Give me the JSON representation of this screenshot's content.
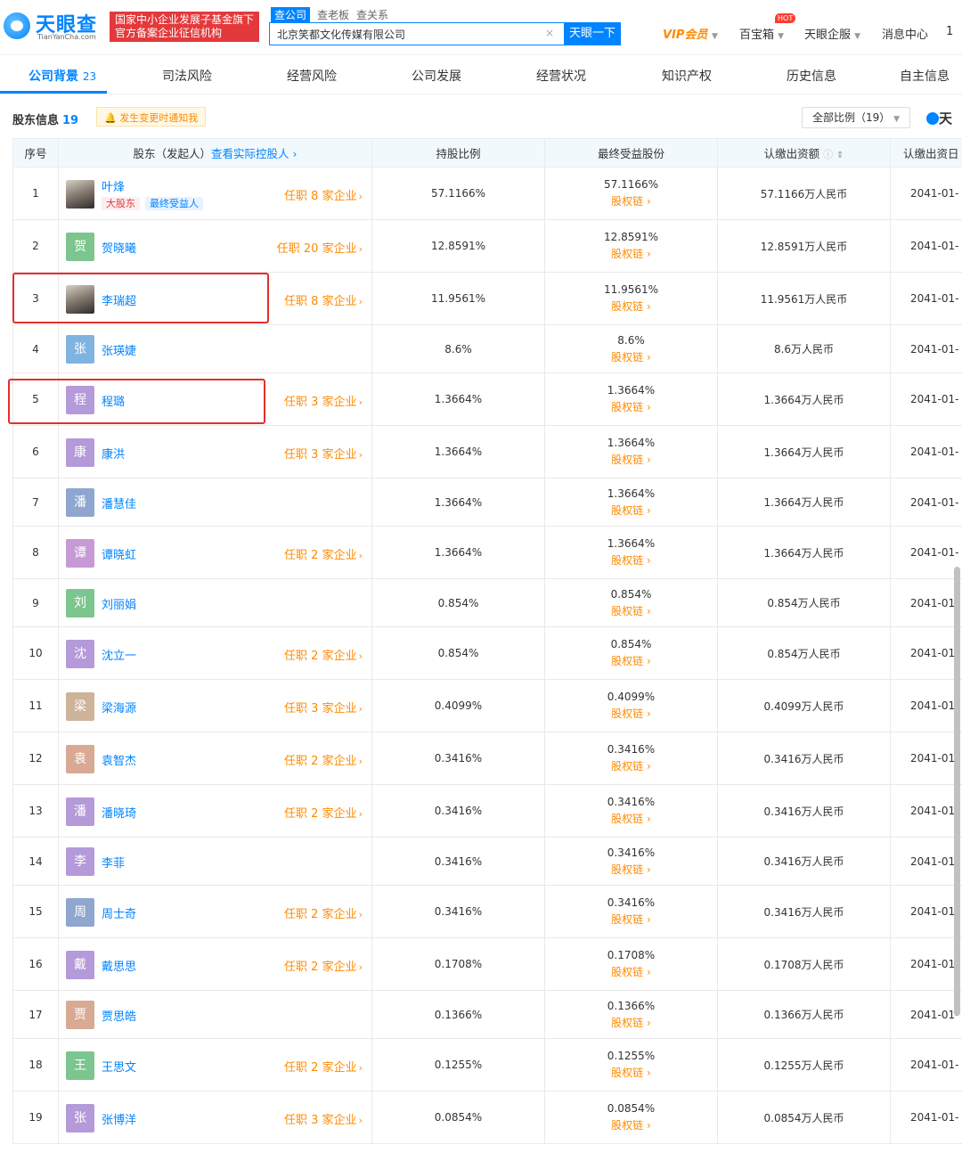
{
  "brand": {
    "name": "天眼查",
    "domain": "TianYanCha.com",
    "banner_line1": "国家中小企业发展子基金旗下",
    "banner_line2": "官方备案企业征信机构"
  },
  "search": {
    "tabs": [
      "查公司",
      "查老板",
      "查关系"
    ],
    "value": "北京笑都文化传媒有限公司",
    "clear": "×",
    "button": "天眼一下"
  },
  "nav": {
    "vip": "VIP会员",
    "baobox": "百宝箱",
    "hot": "HOT",
    "enterprise": "天眼企服",
    "messages": "消息中心",
    "extra": "1"
  },
  "tabs": [
    {
      "label": "公司背景",
      "count": "23"
    },
    {
      "label": "司法风险"
    },
    {
      "label": "经营风险"
    },
    {
      "label": "公司发展"
    },
    {
      "label": "经营状况"
    },
    {
      "label": "知识产权"
    },
    {
      "label": "历史信息"
    },
    {
      "label": "自主信息"
    }
  ],
  "section": {
    "title": "股东信息",
    "count": "19",
    "notify": "发生变更时通知我",
    "filter": "全部比例（19）",
    "brand_short": "天"
  },
  "table": {
    "headers": {
      "seq": "序号",
      "holder": "股东（发起人）",
      "holder_link": "查看实际控股人",
      "ratio": "持股比例",
      "benefit": "最终受益股份",
      "capital": "认缴出资额",
      "date": "认缴出资日"
    },
    "chain_label": "股权链",
    "tags": {
      "major": "大股东",
      "beneficiary": "最终受益人"
    },
    "rows": [
      {
        "seq": "1",
        "name": "叶烽",
        "avatar": "",
        "color": "",
        "serve": "任职 8 家企业",
        "ratio": "57.1166%",
        "benefit": "57.1166%",
        "capital": "57.1166万人民币",
        "date": "2041-01-"
      },
      {
        "seq": "2",
        "name": "贺晓曦",
        "avatar": "贺",
        "color": "#7cc58e",
        "serve": "任职 20 家企业",
        "ratio": "12.8591%",
        "benefit": "12.8591%",
        "capital": "12.8591万人民币",
        "date": "2041-01-"
      },
      {
        "seq": "3",
        "name": "李瑞超",
        "avatar": "",
        "color": "",
        "serve": "任职 8 家企业",
        "ratio": "11.9561%",
        "benefit": "11.9561%",
        "capital": "11.9561万人民币",
        "date": "2041-01-"
      },
      {
        "seq": "4",
        "name": "张瑛婕",
        "avatar": "张",
        "color": "#7fb3e0",
        "serve": "",
        "ratio": "8.6%",
        "benefit": "8.6%",
        "capital": "8.6万人民币",
        "date": "2041-01-"
      },
      {
        "seq": "5",
        "name": "程璐",
        "avatar": "程",
        "color": "#b49ad9",
        "serve": "任职 3 家企业",
        "ratio": "1.3664%",
        "benefit": "1.3664%",
        "capital": "1.3664万人民币",
        "date": "2041-01-"
      },
      {
        "seq": "6",
        "name": "康洪",
        "avatar": "康",
        "color": "#b49ad9",
        "serve": "任职 3 家企业",
        "ratio": "1.3664%",
        "benefit": "1.3664%",
        "capital": "1.3664万人民币",
        "date": "2041-01-"
      },
      {
        "seq": "7",
        "name": "潘慧佳",
        "avatar": "潘",
        "color": "#8fa6cf",
        "serve": "",
        "ratio": "1.3664%",
        "benefit": "1.3664%",
        "capital": "1.3664万人民币",
        "date": "2041-01-"
      },
      {
        "seq": "8",
        "name": "谭晓虹",
        "avatar": "谭",
        "color": "#c79ad6",
        "serve": "任职 2 家企业",
        "ratio": "1.3664%",
        "benefit": "1.3664%",
        "capital": "1.3664万人民币",
        "date": "2041-01-"
      },
      {
        "seq": "9",
        "name": "刘丽娟",
        "avatar": "刘",
        "color": "#7cc58e",
        "serve": "",
        "ratio": "0.854%",
        "benefit": "0.854%",
        "capital": "0.854万人民币",
        "date": "2041-01-"
      },
      {
        "seq": "10",
        "name": "沈立一",
        "avatar": "沈",
        "color": "#b49ad9",
        "serve": "任职 2 家企业",
        "ratio": "0.854%",
        "benefit": "0.854%",
        "capital": "0.854万人民币",
        "date": "2041-01-"
      },
      {
        "seq": "11",
        "name": "梁海源",
        "avatar": "梁",
        "color": "#cdb39a",
        "serve": "任职 3 家企业",
        "ratio": "0.4099%",
        "benefit": "0.4099%",
        "capital": "0.4099万人民币",
        "date": "2041-01-"
      },
      {
        "seq": "12",
        "name": "袁智杰",
        "avatar": "袁",
        "color": "#d8a993",
        "serve": "任职 2 家企业",
        "ratio": "0.3416%",
        "benefit": "0.3416%",
        "capital": "0.3416万人民币",
        "date": "2041-01-"
      },
      {
        "seq": "13",
        "name": "潘晓琦",
        "avatar": "潘",
        "color": "#b49ad9",
        "serve": "任职 2 家企业",
        "ratio": "0.3416%",
        "benefit": "0.3416%",
        "capital": "0.3416万人民币",
        "date": "2041-01-"
      },
      {
        "seq": "14",
        "name": "李菲",
        "avatar": "李",
        "color": "#b49ad9",
        "serve": "",
        "ratio": "0.3416%",
        "benefit": "0.3416%",
        "capital": "0.3416万人民币",
        "date": "2041-01-"
      },
      {
        "seq": "15",
        "name": "周士奇",
        "avatar": "周",
        "color": "#8fa6cf",
        "serve": "任职 2 家企业",
        "ratio": "0.3416%",
        "benefit": "0.3416%",
        "capital": "0.3416万人民币",
        "date": "2041-01-"
      },
      {
        "seq": "16",
        "name": "戴思思",
        "avatar": "戴",
        "color": "#b49ad9",
        "serve": "任职 2 家企业",
        "ratio": "0.1708%",
        "benefit": "0.1708%",
        "capital": "0.1708万人民币",
        "date": "2041-01-"
      },
      {
        "seq": "17",
        "name": "贾思皓",
        "avatar": "贾",
        "color": "#d8a993",
        "serve": "",
        "ratio": "0.1366%",
        "benefit": "0.1366%",
        "capital": "0.1366万人民币",
        "date": "2041-01-"
      },
      {
        "seq": "18",
        "name": "王思文",
        "avatar": "王",
        "color": "#7cc58e",
        "serve": "任职 2 家企业",
        "ratio": "0.1255%",
        "benefit": "0.1255%",
        "capital": "0.1255万人民币",
        "date": "2041-01-"
      },
      {
        "seq": "19",
        "name": "张博洋",
        "avatar": "张",
        "color": "#b49ad9",
        "serve": "任职 3 家企业",
        "ratio": "0.0854%",
        "benefit": "0.0854%",
        "capital": "0.0854万人民币",
        "date": "2041-01-"
      }
    ]
  }
}
